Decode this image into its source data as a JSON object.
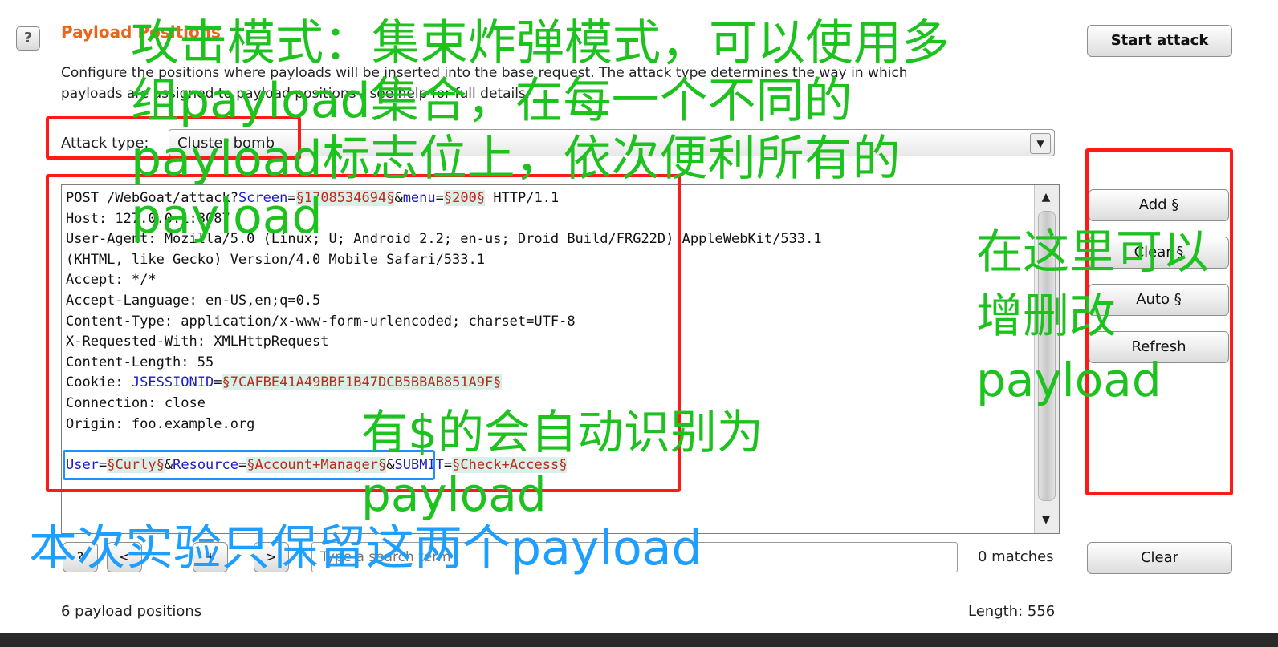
{
  "panel": {
    "title": "Payload Positions",
    "description_line1": "Configure the positions where payloads will be inserted into the base request. The attack type determines the way in which",
    "description_line2": "payloads are assigned to payload positions - see help for full details.",
    "help_glyph": "?"
  },
  "attack_type": {
    "label": "Attack type:",
    "value": "Cluster bomb",
    "arrow": "▼"
  },
  "buttons": {
    "start_attack": "Start attack",
    "add": "Add §",
    "clear_pos": "Clear §",
    "auto": "Auto §",
    "refresh": "Refresh",
    "clear": "Clear",
    "nav_help": "?",
    "nav_prev": "<",
    "nav_add": "+",
    "nav_next": ">"
  },
  "request": {
    "line1": {
      "pre": "POST /WebGoat/attack?",
      "n1": "Screen",
      "eq1": "=",
      "v1": "§1708534694§",
      "amp1": "&",
      "n2": "menu",
      "eq2": "=",
      "v2": "§200§",
      "post": " HTTP/1.1"
    },
    "host": "Host: 127.0.0.1:8087",
    "ua1": "User-Agent: Mozilla/5.0 (Linux; U; Android 2.2; en-us; Droid Build/FRG22D) AppleWebKit/533.1",
    "ua2": "(KHTML, like Gecko) Version/4.0 Mobile Safari/533.1",
    "accept": "Accept: */*",
    "accept_lang": "Accept-Language: en-US,en;q=0.5",
    "content_type": "Content-Type: application/x-www-form-urlencoded; charset=UTF-8",
    "xrw": "X-Requested-With: XMLHttpRequest",
    "content_length": "Content-Length: 55",
    "cookie": {
      "pre": "Cookie: ",
      "n": "JSESSIONID",
      "eq": "=",
      "v": "§7CAFBE41A49BBF1B47DCB5BBAB851A9F§"
    },
    "connection": "Connection: close",
    "origin": "Origin: foo.example.org",
    "body": {
      "n1": "User",
      "eq1": "=",
      "v1": "§Curly§",
      "amp1": "&",
      "n2": "Resource",
      "eq2": "=",
      "v2": "§Account+Manager§",
      "amp2": "&",
      "n3": "SUBMIT",
      "eq3": "=",
      "v3": "§Check+Access§"
    }
  },
  "scrollbar": {
    "up": "▲",
    "down": "▼"
  },
  "search": {
    "placeholder": "Type a search term",
    "matches": "0 matches"
  },
  "status": {
    "positions": "6 payload positions",
    "length": "Length: 556"
  },
  "annotations": {
    "green_main_1": "攻击模式：集束炸弹模式，可以使用多",
    "green_main_2": "组payload集合，在每一个不同的",
    "green_main_3": "payload标志位上，依次便利所有的",
    "green_main_4": "payload",
    "green_side_1": "在这里可以",
    "green_side_2": "增删改",
    "green_side_3": "payload",
    "green_mid_1": "有$的会自动识别为",
    "green_mid_2": "payload",
    "blue_note": "本次实验只保留这两个payload"
  },
  "colors": {
    "title": "#e8651a",
    "red_box": "#ff1a1a",
    "green_text": "#1ec21e",
    "blue_text": "#1e9fff"
  }
}
